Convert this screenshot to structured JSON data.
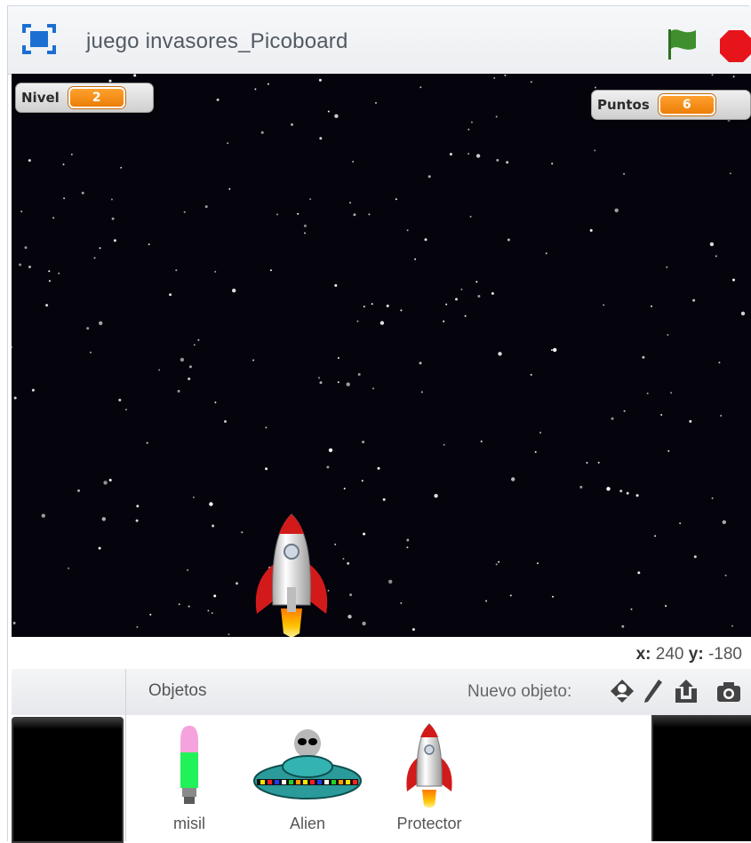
{
  "window": {
    "title": "juego invasores_Picoboard"
  },
  "stage": {
    "monitors": [
      {
        "label": "Nivel",
        "value": "2"
      },
      {
        "label": "Puntos",
        "value": "6"
      }
    ]
  },
  "coords": {
    "x_label": "x:",
    "x_value": "240",
    "y_label": "y:",
    "y_value": "-180"
  },
  "sprites_panel": {
    "header_label": "Objetos",
    "new_sprite_label": "Nuevo objeto:",
    "tools": [
      "choose-sprite-icon",
      "paint-brush-icon",
      "upload-icon",
      "camera-icon"
    ],
    "sprites": [
      {
        "name": "misil"
      },
      {
        "name": "Alien"
      },
      {
        "name": "Protector"
      }
    ]
  },
  "colors": {
    "accent": "#f58a0d",
    "flag": "#3f8f2e",
    "stop": "#e8141b",
    "stage_bg": "#05040c"
  }
}
